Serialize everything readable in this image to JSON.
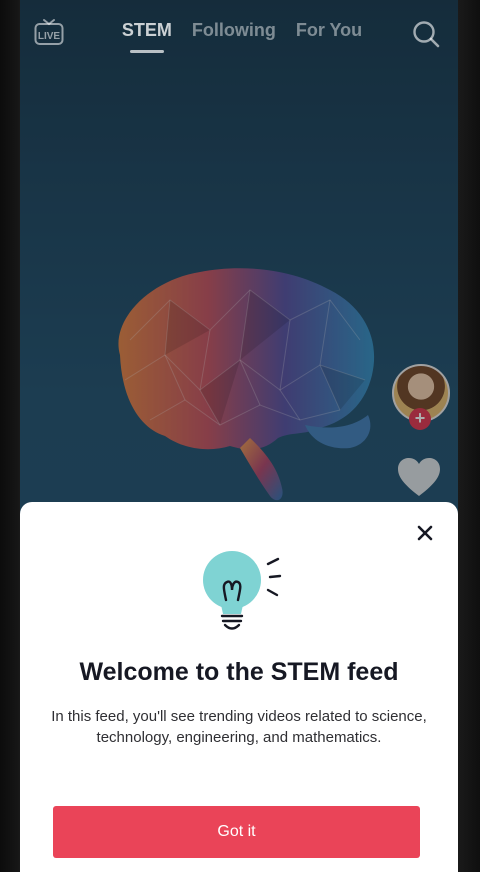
{
  "topbar": {
    "live_label": "LIVE",
    "tabs": [
      {
        "label": "STEM",
        "active": true
      },
      {
        "label": "Following",
        "active": false
      },
      {
        "label": "For You",
        "active": false
      }
    ]
  },
  "video": {
    "creator_avatar": "avatar",
    "follow_badge": "+"
  },
  "sheet": {
    "title": "Welcome to the STEM feed",
    "body": "In this feed, you'll see trending videos related to science, technology, engineering, and mathematics.",
    "button_label": "Got it"
  },
  "colors": {
    "accent": "#ea4458",
    "background": "#2c5d7b",
    "bulb": "#7fd3d3"
  }
}
